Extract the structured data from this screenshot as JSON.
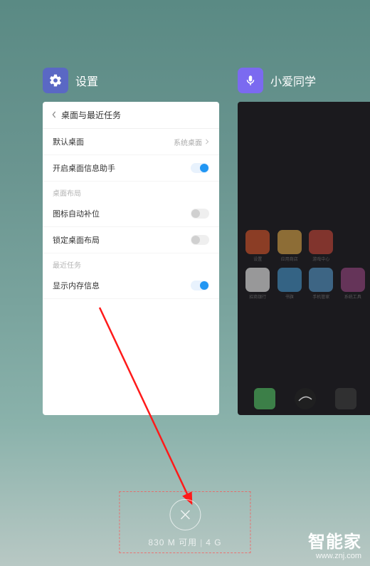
{
  "recents": {
    "cards": [
      {
        "title": "设置",
        "icon": "gear"
      },
      {
        "title": "小爱同学",
        "icon": "mic"
      }
    ]
  },
  "settings_panel": {
    "header": "桌面与最近任务",
    "rows": [
      {
        "label": "默认桌面",
        "value": "系统桌面"
      }
    ],
    "toggle_rows": [
      {
        "label": "开启桌面信息助手",
        "on": true
      }
    ],
    "section_layout": "桌面布局",
    "layout_rows": [
      {
        "label": "图标自动补位",
        "on": false
      },
      {
        "label": "锁定桌面布局",
        "on": false
      }
    ],
    "section_recent": "最近任务",
    "recent_rows": [
      {
        "label": "显示内存信息",
        "on": true
      }
    ]
  },
  "memory": {
    "available": "830 M 可用",
    "total": "4 G"
  },
  "watermark": {
    "brand": "智能家",
    "url": "www.znj.com"
  }
}
